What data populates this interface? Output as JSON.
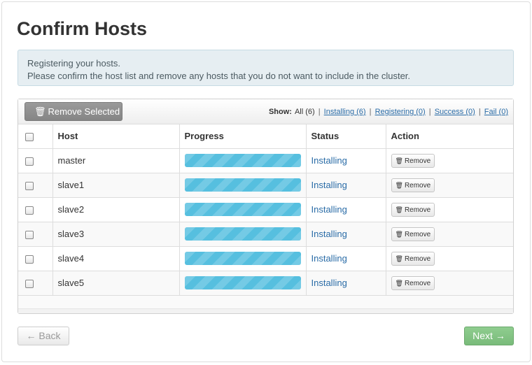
{
  "page": {
    "title": "Confirm Hosts",
    "info_line1": "Registering your hosts.",
    "info_line2": "Please confirm the host list and remove any hosts that you do not want to include in the cluster."
  },
  "toolbar": {
    "remove_selected_label": "Remove Selected",
    "show_label": "Show:",
    "filter_all": "All (6)",
    "filter_installing": "Installing (6)",
    "filter_registering": "Registering (0)",
    "filter_success": "Success (0)",
    "filter_fail": "Fail (0)",
    "separator": "|"
  },
  "table": {
    "columns": [
      "Host",
      "Progress",
      "Status",
      "Action"
    ],
    "rows": [
      {
        "host": "master",
        "progress": 1.0,
        "status": "Installing",
        "action": "Remove"
      },
      {
        "host": "slave1",
        "progress": 1.0,
        "status": "Installing",
        "action": "Remove"
      },
      {
        "host": "slave2",
        "progress": 1.0,
        "status": "Installing",
        "action": "Remove"
      },
      {
        "host": "slave3",
        "progress": 1.0,
        "status": "Installing",
        "action": "Remove"
      },
      {
        "host": "slave4",
        "progress": 1.0,
        "status": "Installing",
        "action": "Remove"
      },
      {
        "host": "slave5",
        "progress": 1.0,
        "status": "Installing",
        "action": "Remove"
      }
    ]
  },
  "footer": {
    "back_label": "← Back",
    "next_label": "Next →"
  },
  "icons": {
    "trash": "trash-icon"
  },
  "colors": {
    "progress_fill": "#56bfdf",
    "next_button": "#7fc17f",
    "link": "#2a6ca7"
  }
}
